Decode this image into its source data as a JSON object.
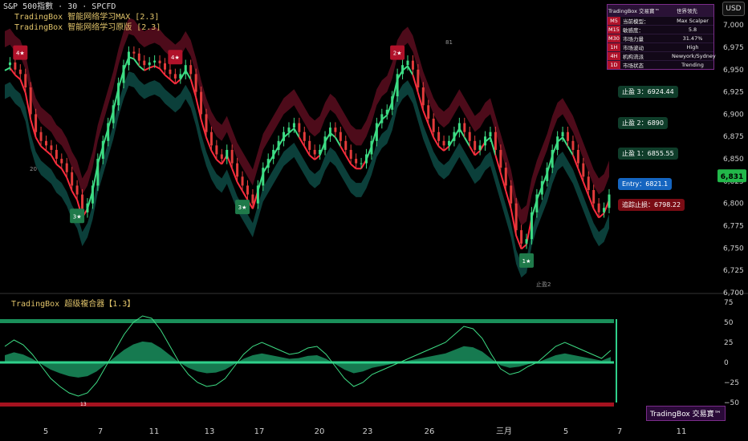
{
  "legend": {
    "symbol": "S&P 500指數 · 30 · SPCFD",
    "indicators": [
      "TradingBox  智能网络学习MAX [2.3]",
      "TradingBox  智能网络学习原版 [2.3]"
    ]
  },
  "currency": "USD",
  "sub_title": "TradingBox  超级複合器【1.3】",
  "brand": "TradingBox 交易寶™",
  "info_panel": {
    "header": [
      "TradingBox 交易寶™",
      "世界领先"
    ],
    "rows": [
      {
        "tf": "M5",
        "key": "当前模型：",
        "val": "Max Scalper"
      },
      {
        "tf": "M15",
        "key": "敏感度：",
        "val": "5.8"
      },
      {
        "tf": "M30",
        "key": "市场力量",
        "val": "31.47%"
      },
      {
        "tf": "1H",
        "key": "市场波动",
        "val": "High"
      },
      {
        "tf": "4H",
        "key": "机构流派",
        "val": "Newyork/Sydney"
      },
      {
        "tf": "1D",
        "key": "市场状态",
        "val": "Trending"
      }
    ]
  },
  "levels": [
    {
      "label": "止盈 3：6924.44",
      "price": 6924.44,
      "color": "#0f3d2a"
    },
    {
      "label": "止盈 2：6890",
      "price": 6890,
      "color": "#0f3d2a"
    },
    {
      "label": "止盈 1：6855.55",
      "price": 6855.55,
      "color": "#0f3d2a"
    },
    {
      "label": "Entry：6821.1",
      "price": 6821.1,
      "color": "#1565c0"
    },
    {
      "label": "追踪止损：6798.22",
      "price": 6798.22,
      "color": "#7a0c14"
    }
  ],
  "chart_data": [
    {
      "type": "line",
      "title": "S&P 500指數 · 30 · SPCFD",
      "x_ticks": [
        "5",
        "7",
        "11",
        "13",
        "17",
        "20",
        "23",
        "26",
        "三月",
        "5",
        "7",
        "11"
      ],
      "y_ticks": [
        "7,000",
        "6,975",
        "6,950",
        "6,925",
        "6,900",
        "6,875",
        "6,850",
        "6,825",
        "6,800",
        "6,775",
        "6,750",
        "6,725",
        "6,700"
      ],
      "ylim": [
        6700,
        7010
      ],
      "last_price": "6,831",
      "series": [
        {
          "values": [
            6955,
            6958,
            6950,
            6945,
            6930,
            6900,
            6880,
            6870,
            6865,
            6860,
            6850,
            6845,
            6835,
            6820,
            6810,
            6790,
            6800,
            6820,
            6850,
            6870,
            6890,
            6910,
            6935,
            6955,
            6970,
            6968,
            6960,
            6955,
            6958,
            6960,
            6957,
            6950,
            6945,
            6940,
            6945,
            6955,
            6945,
            6925,
            6900,
            6880,
            6865,
            6855,
            6850,
            6860,
            6845,
            6830,
            6820,
            6810,
            6800,
            6820,
            6840,
            6850,
            6860,
            6870,
            6880,
            6885,
            6890,
            6880,
            6870,
            6860,
            6855,
            6860,
            6875,
            6885,
            6880,
            6870,
            6860,
            6850,
            6845,
            6845,
            6855,
            6870,
            6890,
            6900,
            6905,
            6920,
            6945,
            6955,
            6960,
            6950,
            6930,
            6910,
            6895,
            6880,
            6870,
            6865,
            6870,
            6880,
            6890,
            6880,
            6870,
            6860,
            6865,
            6875,
            6880,
            6860,
            6840,
            6820,
            6800,
            6770,
            6755,
            6760,
            6790,
            6810,
            6825,
            6840,
            6860,
            6875,
            6880,
            6870,
            6860,
            6845,
            6830,
            6815,
            6800,
            6790,
            6795,
            6810
          ]
        }
      ],
      "markers": [
        {
          "label": "4★",
          "dir": "sell",
          "i": 3
        },
        {
          "label": "4★",
          "dir": "sell",
          "i": 33
        },
        {
          "label": "2★",
          "dir": "sell",
          "i": 76
        },
        {
          "label": "3★",
          "dir": "buy",
          "i": 14
        },
        {
          "label": "3★",
          "dir": "buy",
          "i": 46
        },
        {
          "label": "1★",
          "dir": "buy",
          "i": 101
        }
      ],
      "annotations": [
        "20",
        "81",
        "止盈2"
      ]
    },
    {
      "type": "line",
      "title": "TradingBox  超级複合器【1.3】",
      "y_ticks": [
        "75",
        "50",
        "25",
        "0",
        "−25",
        "−50"
      ],
      "ylim": [
        -58,
        80
      ],
      "series": [
        {
          "values": [
            20,
            28,
            22,
            10,
            -5,
            -20,
            -30,
            -38,
            -42,
            -38,
            -25,
            -5,
            15,
            35,
            50,
            58,
            55,
            40,
            20,
            0,
            -15,
            -25,
            -30,
            -28,
            -20,
            -5,
            10,
            20,
            25,
            20,
            15,
            10,
            12,
            18,
            20,
            10,
            -5,
            -20,
            -30,
            -25,
            -15,
            -10,
            -5,
            0,
            5,
            10,
            15,
            20,
            25,
            35,
            45,
            42,
            30,
            10,
            -8,
            -15,
            -12,
            -5,
            0,
            10,
            20,
            25,
            20,
            15,
            10,
            5,
            15
          ]
        }
      ],
      "annotations": [
        "13"
      ]
    }
  ]
}
